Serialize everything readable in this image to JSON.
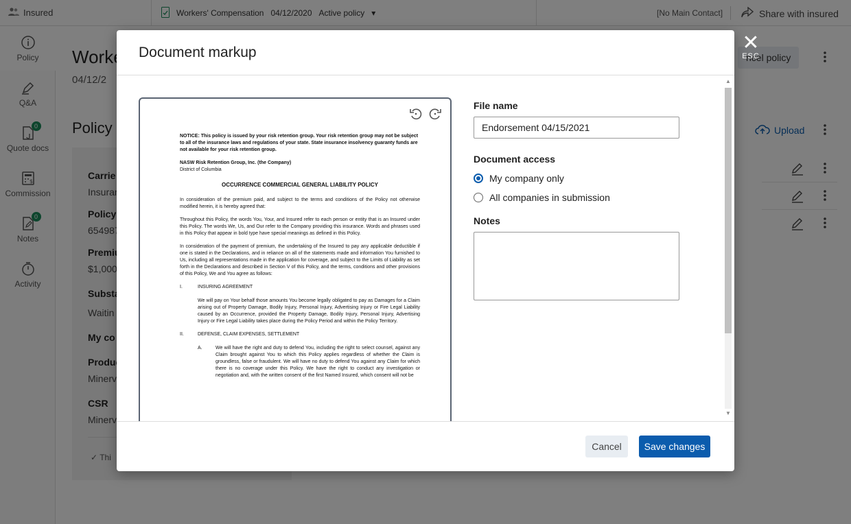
{
  "topbar": {
    "insured_label": "Insured",
    "policy_line": "Workers' Compensation",
    "policy_date": "04/12/2020",
    "policy_status": "Active policy",
    "main_contact": "[No Main Contact]",
    "share_label": "Share with insured"
  },
  "leftnav": {
    "items": [
      {
        "label": "Policy"
      },
      {
        "label": "Q&A"
      },
      {
        "label": "Quote docs",
        "badge": "0"
      },
      {
        "label": "Commission"
      },
      {
        "label": "Notes",
        "badge": "0"
      },
      {
        "label": "Activity"
      }
    ]
  },
  "main": {
    "title": "Worke",
    "date": "04/12/2",
    "cancel_policy": "ncel policy",
    "section_title": "Policy",
    "upload_label": "Upload",
    "fields": [
      {
        "label": "Carrie",
        "value": "Insurar"
      },
      {
        "label": "Policy",
        "value": "654987"
      },
      {
        "label": "Premiu",
        "value": "$1,000"
      },
      {
        "label": "Substa",
        "value": "Waitin"
      },
      {
        "label": "My co",
        "value": ""
      },
      {
        "label": "Produc",
        "value": "Minerv"
      },
      {
        "label": "CSR",
        "value": "Minerv"
      }
    ],
    "check_text": "Thi"
  },
  "modal": {
    "title": "Document markup",
    "close_label": "ESC",
    "file_name_label": "File name",
    "file_name_value": "Endorsement 04/15/2021",
    "access_label": "Document access",
    "access_options": [
      "My company only",
      "All companies in submission"
    ],
    "access_selected": "My company only",
    "notes_label": "Notes",
    "notes_value": "",
    "cancel_label": "Cancel",
    "save_label": "Save changes"
  },
  "document": {
    "notice": "NOTICE: This policy is issued by your risk retention group. Your risk retention group may not be subject to all of the insurance laws and regulations of your state. State insurance insolvency guaranty funds are not available for your risk retention group.",
    "issuer": "NASW Risk Retention Group, Inc. (the Company)",
    "district": "District of Columbia",
    "heading": "OCCURRENCE COMMERCIAL GENERAL LIABILITY POLICY",
    "para1": "In consideration of the premium paid, and subject to the terms and conditions of the Policy not otherwise modified herein, it is hereby agreed that:",
    "para2": "Throughout this Policy, the words You, Your, and Insured refer to each person or entity that is an Insured under this Policy. The words We, Us, and Our refer to the Company providing this insurance. Words and phrases used in this Policy that appear in bold type have special meanings as defined in this Policy.",
    "para3": "In consideration of the payment of premium, the undertaking of the Insured to pay any applicable deductible if one is stated in the Declarations, and in reliance on all of the statements made and information You furnished to Us, including all representations made in the application for coverage, and subject to the Limits of Liability as set forth in the Declarations and described in Section V of this Policy, and the terms, conditions and other provisions of this Policy, We and You agree as follows:",
    "sec1_num": "I.",
    "sec1_title": "INSURING AGREEMENT",
    "sec1_text": "We will pay on Your behalf those amounts You become legally obligated to pay as Damages for a Claim arising out of Property Damage, Bodily Injury, Personal Injury, Advertising Injury or Fire Legal Liability caused by an Occurrence, provided the Property Damage, Bodily Injury, Personal Injury, Advertising Injury or Fire Legal Liability takes place during the Policy Period and within the Policy Territory.",
    "sec2_num": "II.",
    "sec2_title": "DEFENSE, CLAIM EXPENSES, SETTLEMENT",
    "secA_num": "A.",
    "secA_text": "We will have the right and duty to defend You, including the right to select counsel, against any Claim brought against You to which this Policy applies regardless of whether the Claim is groundless, false or fraudulent. We will have no duty to defend You against any Claim for which there is no coverage under this Policy. We have the right to conduct any investigation or negotiation and, with the written consent of the first Named Insured, which consent will not be"
  },
  "colors": {
    "primary": "#0b5cad",
    "badge": "#1a8a5a",
    "overlay": "rgba(0,0,0,0.5)"
  }
}
